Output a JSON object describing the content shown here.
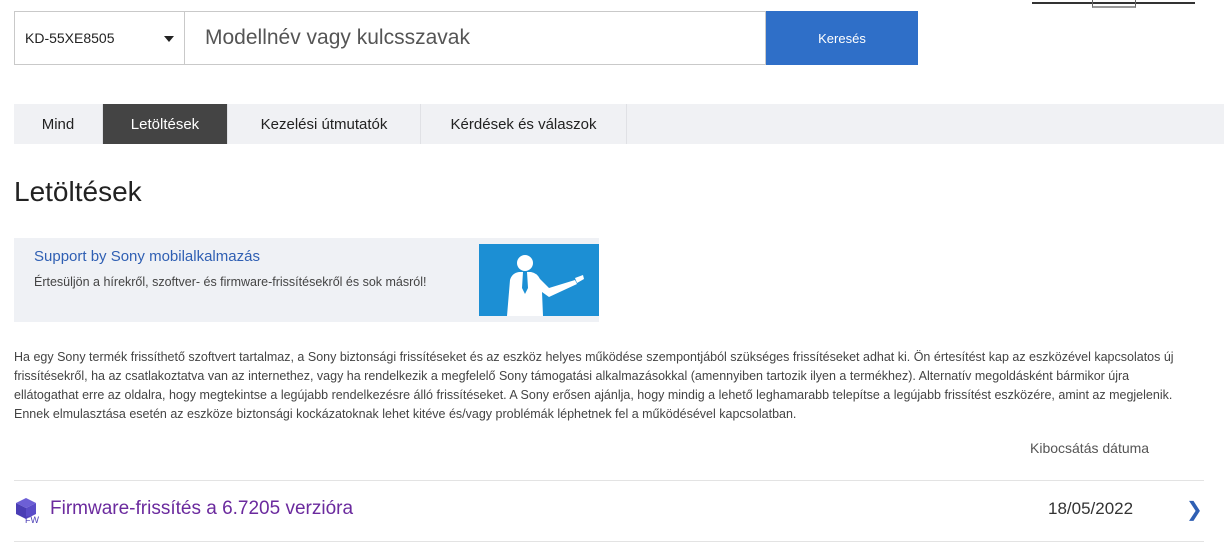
{
  "search": {
    "model_value": "KD-55XE8505",
    "placeholder": "Modellnév vagy kulcsszavak",
    "button_label": "Keresés"
  },
  "tabs": [
    {
      "label": "Mind",
      "active": false
    },
    {
      "label": "Letöltések",
      "active": true
    },
    {
      "label": "Kezelési útmutatók",
      "active": false
    },
    {
      "label": "Kérdések és válaszok",
      "active": false
    }
  ],
  "page": {
    "title": "Letöltések"
  },
  "promo": {
    "link": "Support by Sony mobilalkalmazás",
    "text": "Értesüljön a hírekről, szoftver- és firmware-frissítésekről és sok másról!"
  },
  "notice": "Ha egy Sony termék frissíthető szoftvert tartalmaz, a Sony biztonsági frissítéseket és az eszköz helyes működése szempontjából szükséges frissítéseket adhat ki. Ön értesítést kap az eszközével kapcsolatos új frissítésekről, ha az csatlakoztatva van az internethez, vagy ha rendelkezik a megfelelő Sony támogatási alkalmazásokkal (amennyiben tartozik ilyen a termékhez). Alternatív megoldásként bármikor újra ellátogathat erre az oldalra, hogy megtekintse a legújabb rendelkezésre álló frissítéseket. A Sony erősen ajánlja, hogy mindig a lehető leghamarabb telepítse a legújabb frissítést eszközére, amint az megjelenik. Ennek elmulasztása esetén az eszköze biztonsági kockázatoknak lehet kitéve és/vagy problémák léphetnek fel a működésével kapcsolatban.",
  "downloads": {
    "date_header": "Kibocsátás dátuma",
    "items": [
      {
        "icon": "firmware-icon",
        "icon_label": "FW",
        "title": "Firmware-frissítés a 6.7205 verzióra",
        "date": "18/05/2022"
      }
    ]
  },
  "colors": {
    "accent": "#2f6fc8",
    "download_title": "#6b2a9e",
    "active_tab": "#444444",
    "promo_image": "#1c8fd4"
  }
}
